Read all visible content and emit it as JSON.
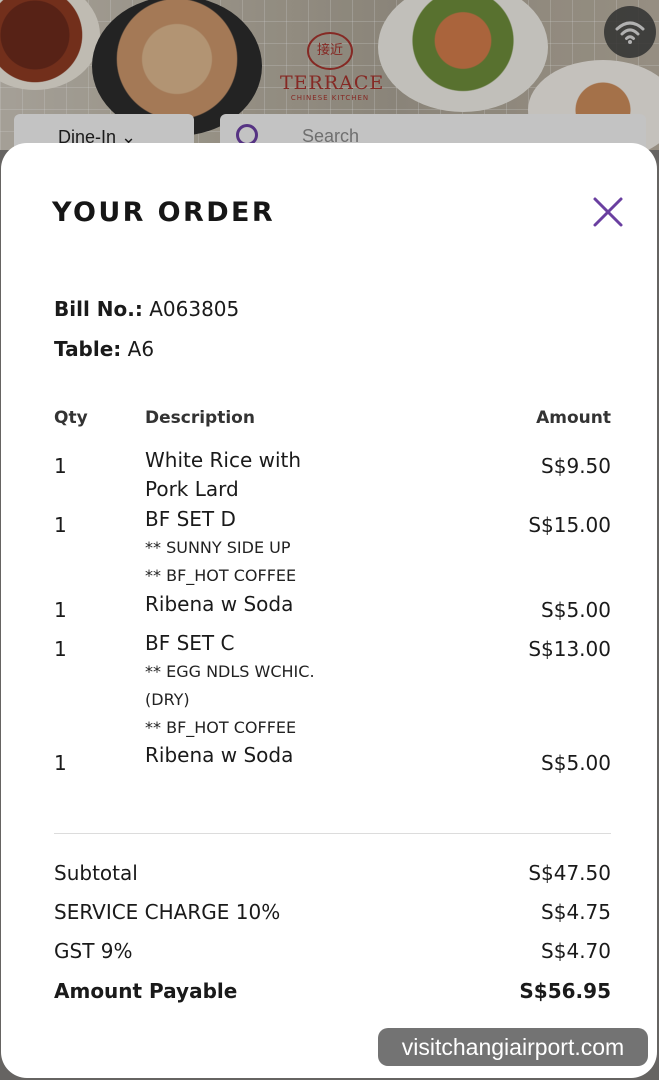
{
  "background": {
    "logo_text": "TERRACE",
    "logo_subtext": "CHINESE KITCHEN",
    "dine_mode": "Dine-In",
    "search_placeholder": "Search"
  },
  "modal": {
    "title": "YOUR ORDER",
    "bill_label": "Bill No.:",
    "bill_no": "A063805",
    "table_label": "Table:",
    "table_no": "A6",
    "columns": {
      "qty": "Qty",
      "description": "Description",
      "amount": "Amount"
    },
    "items": [
      {
        "qty": "1",
        "description": "White Rice with Pork Lard",
        "modifiers": [],
        "amount": "S$9.50"
      },
      {
        "qty": "1",
        "description": "BF SET D",
        "modifiers": [
          "** SUNNY SIDE UP",
          "** BF_HOT COFFEE"
        ],
        "amount": "S$15.00"
      },
      {
        "qty": "1",
        "description": "Ribena w Soda",
        "modifiers": [],
        "amount": "S$5.00"
      },
      {
        "qty": "1",
        "description": "BF SET C",
        "modifiers": [
          "** EGG NDLS WCHIC.(DRY)",
          "** BF_HOT COFFEE"
        ],
        "amount": "S$13.00"
      },
      {
        "qty": "1",
        "description": "Ribena w Soda",
        "modifiers": [],
        "amount": "S$5.00"
      }
    ],
    "summary": {
      "subtotal_label": "Subtotal",
      "subtotal": "S$47.50",
      "service_label": "SERVICE CHARGE 10%",
      "service": "S$4.75",
      "gst_label": "GST 9%",
      "gst": "S$4.70",
      "payable_label": "Amount Payable",
      "payable": "S$56.95"
    }
  },
  "watermark": "visitchangiairport.com",
  "colors": {
    "accent": "#6a3fa0",
    "text": "#1a1a1a",
    "logo_red": "#a3322c"
  },
  "icons": {
    "close": "close-icon",
    "wifi": "wifi-icon",
    "search": "search-icon"
  }
}
